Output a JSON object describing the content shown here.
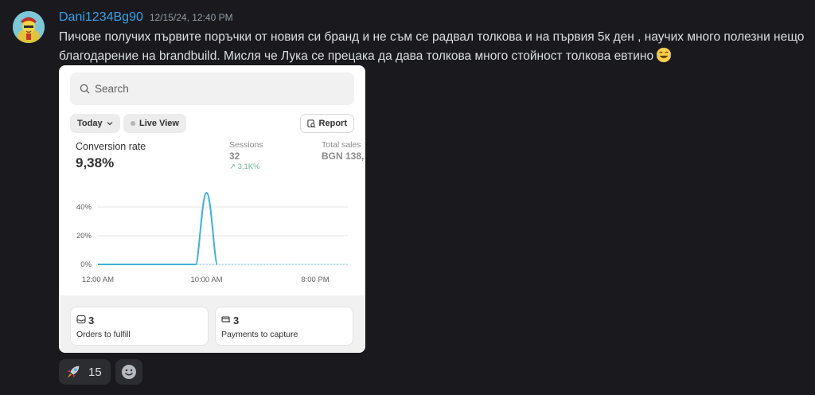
{
  "message": {
    "username": "Dani1234Bg90",
    "timestamp": "12/15/24, 12:40 PM",
    "text": "Пичове получих първите поръчки от новия си бранд и не съм се радвал толкова и на първия 5к ден , научих много полезни нещо благодарение на brandbuild. Мисля че Лука се прецака да дава толкова много стойност толкова евтино",
    "inline_emoji": "joy-emoji"
  },
  "screenshot": {
    "search_placeholder": "Search",
    "filter_today": "Today",
    "filter_live": "Live View",
    "report_button": "Report",
    "conversion_label": "Conversion rate",
    "conversion_value": "9,38%",
    "sessions_label": "Sessions",
    "sessions_value": "32",
    "sessions_change": "↗ 3,1K%",
    "total_sales_label": "Total sales",
    "total_sales_value": "BGN 138,",
    "orders_count": "3",
    "orders_label": "Orders to fulfill",
    "payments_count": "3",
    "payments_label": "Payments to capture"
  },
  "chart_data": {
    "type": "line",
    "x_ticks": [
      "12:00 AM",
      "10:00 AM",
      "8:00 PM"
    ],
    "y_ticks": [
      "0%",
      "20%",
      "40%"
    ],
    "ylim": [
      0,
      50
    ],
    "x": [
      0,
      4,
      8,
      9,
      9.6,
      10,
      10.4,
      11,
      12,
      16,
      20,
      23
    ],
    "values": [
      0,
      0,
      0,
      0,
      5,
      50,
      5,
      0,
      null,
      null,
      null,
      null
    ],
    "comparison": [
      0,
      0,
      0,
      0,
      0,
      0,
      0,
      0,
      0,
      0,
      0,
      0
    ],
    "color": "#3fb0d8"
  },
  "reactions": {
    "rocket_count": "15"
  },
  "colors": {
    "background": "#1a1a1e",
    "username": "#3aa0e8",
    "accent_line": "#3fb0d8"
  }
}
